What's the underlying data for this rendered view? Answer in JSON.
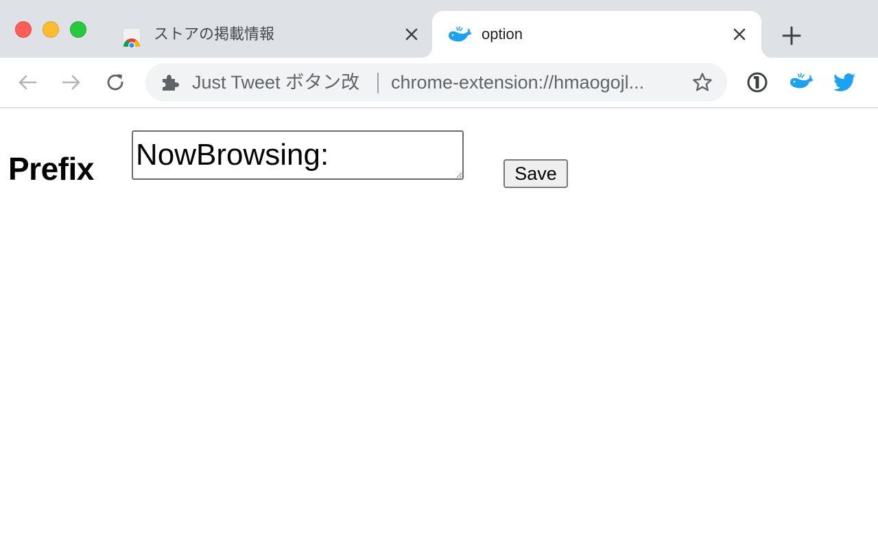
{
  "window": {
    "traffic_lights": [
      "close",
      "minimize",
      "maximize"
    ]
  },
  "tabs": [
    {
      "title": "ストアの掲載情報",
      "icon": "chrome-web-store-icon",
      "active": false
    },
    {
      "title": "option",
      "icon": "blue-whale-icon",
      "active": true
    }
  ],
  "toolbar": {
    "extension_name": "Just Tweet ボタン改",
    "url": "chrome-extension://hmaogojl...",
    "extension_icons": [
      "1password-icon",
      "blue-whale-icon",
      "twitter-bird-icon"
    ]
  },
  "page": {
    "prefix_label": "Prefix",
    "prefix_value": "NowBrowsing:",
    "save_label": "Save"
  },
  "colors": {
    "tabstrip_bg": "#dee1e6",
    "omnibox_bg": "#f1f3f4",
    "accent_blue": "#1da1f2"
  }
}
